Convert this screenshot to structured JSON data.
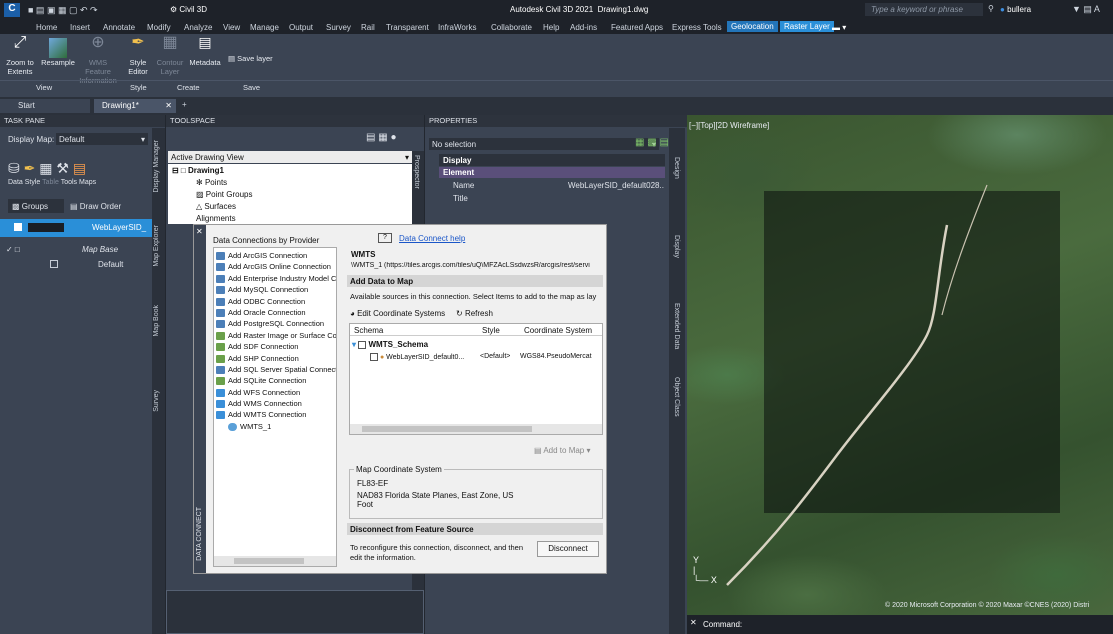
{
  "titlebar": {
    "app_title": "Autodesk Civil 3D 2021",
    "document": "Drawing1.dwg",
    "workspace": "Civil 3D",
    "search_placeholder": "Type a keyword or phrase",
    "user": "bullera"
  },
  "menu_tabs": [
    "Home",
    "Insert",
    "Annotate",
    "Modify",
    "Analyze",
    "View",
    "Manage",
    "Output",
    "Survey",
    "Rail",
    "Transparent",
    "InfraWorks",
    "Collaborate",
    "Help",
    "Add-ins",
    "Featured Apps",
    "Express Tools",
    "Geolocation",
    "Raster Layer"
  ],
  "ribbon": {
    "buttons": [
      {
        "label": "Zoom to Extents"
      },
      {
        "label": "Resample"
      },
      {
        "label": "WMS Feature Information"
      },
      {
        "label": "Style Editor"
      },
      {
        "label": "Contour Layer"
      },
      {
        "label": "Metadata"
      },
      {
        "label": "Save layer"
      }
    ],
    "panels": [
      "View",
      "Style",
      "Create",
      "Save"
    ]
  },
  "file_tabs": [
    "Start",
    "Drawing1*"
  ],
  "task_pane": {
    "header": "TASK PANE",
    "display_map_label": "Display Map:",
    "display_map_value": "Default",
    "tools": [
      "Data",
      "Style",
      "Table",
      "Tools",
      "Maps"
    ],
    "groups_btn": "Groups",
    "draw_order_btn": "Draw Order",
    "layers": [
      {
        "name": "WebLayerSID_"
      },
      {
        "name": "Map Base"
      },
      {
        "name": "Default"
      }
    ],
    "side_tabs": [
      "Display Manager",
      "Map Explorer",
      "Map Book",
      "Survey"
    ]
  },
  "toolspace": {
    "header": "TOOLSPACE",
    "view_select": "Active Drawing View",
    "tree": [
      "Drawing1",
      "Points",
      "Point Groups",
      "Surfaces",
      "Alignments"
    ],
    "side_tabs": [
      "Prospector",
      "DATA CONNECT"
    ]
  },
  "properties": {
    "header": "PROPERTIES",
    "selection": "No selection",
    "sections": [
      "Display",
      "Element"
    ],
    "rows": [
      {
        "key": "Name",
        "value": "WebLayerSID_default028..."
      },
      {
        "key": "Title",
        "value": ""
      }
    ],
    "side_tabs": [
      "Design",
      "Display",
      "Extended Data",
      "Object Class"
    ]
  },
  "data_connect": {
    "help_link": "Data Connect help",
    "providers_title": "Data Connections by Provider",
    "providers": [
      "Add ArcGIS Connection",
      "Add ArcGIS Online Connection",
      "Add Enterprise Industry Model C",
      "Add MySQL Connection",
      "Add ODBC Connection",
      "Add Oracle Connection",
      "Add PostgreSQL Connection",
      "Add Raster Image or Surface Co",
      "Add SDF Connection",
      "Add SHP Connection",
      "Add SQL Server Spatial Connect",
      "Add SQLite Connection",
      "Add WFS Connection",
      "Add WMS Connection",
      "Add WMTS Connection",
      "WMTS_1"
    ],
    "conn_type": "WMTS",
    "conn_url": "\\WMTS_1 (https://tiles.arcgis.com/tiles/uQ\\MFZAcLSsdwzsR/arcgis/rest/servi",
    "add_data_header": "Add Data to Map",
    "available_text": "Available sources in this connection.  Select Items to add to the map as lay",
    "edit_cs_btn": "Edit Coordinate Systems",
    "refresh_btn": "Refresh",
    "columns": [
      "Schema",
      "Style",
      "Coordinate System"
    ],
    "schema_name": "WMTS_Schema",
    "item": {
      "name": "WebLayerSID_default0...",
      "style": "<Default>",
      "cs": "WGS84.PseudoMercat"
    },
    "add_to_map_btn": "Add to Map",
    "map_cs_label": "Map Coordinate System",
    "map_cs_code": "FL83-EF",
    "map_cs_desc": "NAD83 Florida State Planes, East Zone, US Foot",
    "disconnect_header": "Disconnect from Feature Source",
    "disconnect_text": "To reconfigure this connection, disconnect, and then edit the information.",
    "disconnect_btn": "Disconnect"
  },
  "viewport": {
    "label": "[−][Top][2D Wireframe]",
    "copyright": "© 2020 Microsoft Corporation © 2020 Maxar ©CNES (2020) Distri",
    "command_label": "Command:"
  }
}
